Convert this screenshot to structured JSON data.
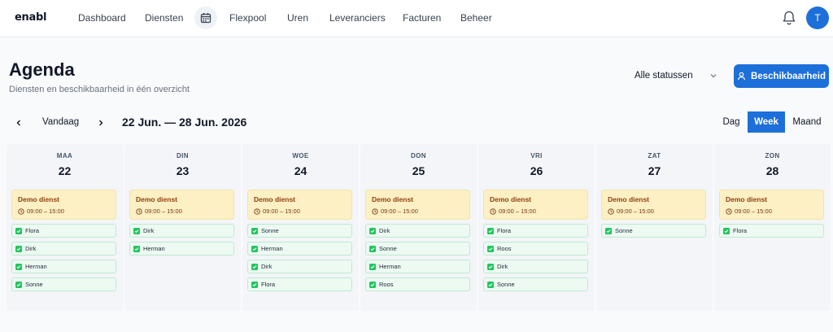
{
  "nav": {
    "logo": "enabl",
    "items": [
      "Dashboard",
      "Diensten",
      "Flexpool",
      "Uren",
      "Leveranciers",
      "Facturen",
      "Beheer"
    ],
    "avatar_initial": "T"
  },
  "header": {
    "title": "Agenda",
    "subtitle": "Diensten en beschikbaarheid in één overzicht",
    "status_filter": "Alle statussen",
    "availability_button": "Beschikbaarheid"
  },
  "toolbar": {
    "today": "Vandaag",
    "range": "22 Jun. — 28 Jun. 2026",
    "views": [
      "Dag",
      "Week",
      "Maand"
    ],
    "active_view": "Week"
  },
  "days": [
    {
      "dow": "MAA",
      "num": "22",
      "shift": {
        "title": "Demo dienst",
        "time": "09:00 – 15:00"
      },
      "people": [
        "Flora",
        "Dirk",
        "Herman",
        "Sonne"
      ]
    },
    {
      "dow": "DIN",
      "num": "23",
      "shift": {
        "title": "Demo dienst",
        "time": "09:00 – 15:00"
      },
      "people": [
        "Dirk",
        "Herman"
      ]
    },
    {
      "dow": "WOE",
      "num": "24",
      "shift": {
        "title": "Demo dienst",
        "time": "09:00 – 15:00"
      },
      "people": [
        "Sonne",
        "Herman",
        "Dirk",
        "Flora"
      ]
    },
    {
      "dow": "DON",
      "num": "25",
      "shift": {
        "title": "Demo dienst",
        "time": "09:00 – 15:00"
      },
      "people": [
        "Dirk",
        "Sonne",
        "Herman",
        "Roos"
      ]
    },
    {
      "dow": "VRI",
      "num": "26",
      "shift": {
        "title": "Demo dienst",
        "time": "09:00 – 15:00"
      },
      "people": [
        "Flora",
        "Roos",
        "Dirk",
        "Sonne"
      ]
    },
    {
      "dow": "ZAT",
      "num": "27",
      "shift": {
        "title": "Demo dienst",
        "time": "09:00 – 15:00"
      },
      "people": [
        "Sonne"
      ]
    },
    {
      "dow": "ZON",
      "num": "28",
      "shift": {
        "title": "Demo dienst",
        "time": "09:00 – 15:00"
      },
      "people": [
        "Flora"
      ]
    }
  ],
  "colors": {
    "primary": "#1d6fd9",
    "shift_bg": "#fdf0c4",
    "person_bg": "#ecfaf2",
    "check": "#22c55e"
  }
}
